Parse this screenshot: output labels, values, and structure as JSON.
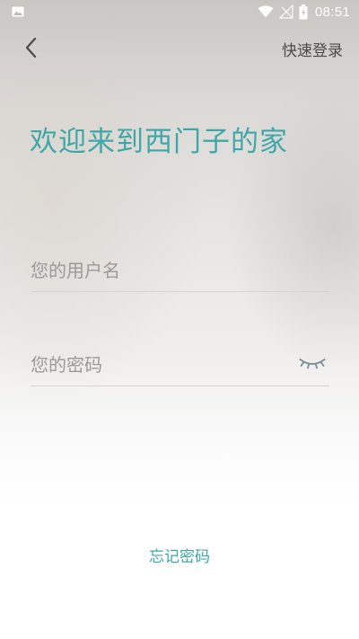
{
  "status_bar": {
    "time": "08:51",
    "left_icon": "image-icon",
    "icons": [
      "wifi-icon",
      "no-signal-icon",
      "battery-icon"
    ]
  },
  "nav": {
    "back_icon": "chevron-left-icon",
    "quick_login_label": "快速登录"
  },
  "title": "欢迎来到西门子的家",
  "form": {
    "username_placeholder": "您的用户名",
    "password_placeholder": "您的密码",
    "eye_icon": "eye-closed-icon"
  },
  "forgot_password_label": "忘记密码",
  "colors": {
    "accent": "#3fa7a7",
    "text_dark": "#4a4a4a",
    "placeholder": "#9a9a9a",
    "divider": "#d4d4d4"
  }
}
